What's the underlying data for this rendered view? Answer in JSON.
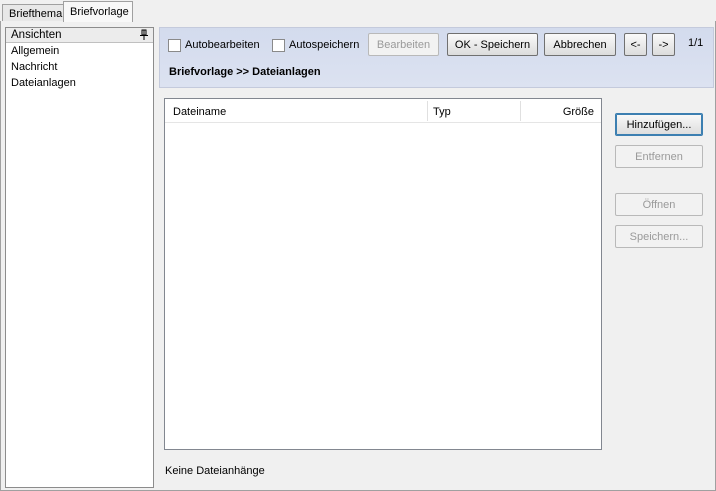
{
  "tabs": [
    {
      "label": "Briefthema",
      "active": false
    },
    {
      "label": "Briefvorlage",
      "active": true
    }
  ],
  "sidebar": {
    "header": "Ansichten",
    "items": [
      {
        "label": "Allgemein"
      },
      {
        "label": "Nachricht"
      },
      {
        "label": "Dateianlagen"
      }
    ]
  },
  "toolbar": {
    "autoedit_label": "Autobearbeiten",
    "autoedit_checked": false,
    "autosave_label": "Autospeichern",
    "autosave_checked": false,
    "edit_label": "Bearbeiten",
    "ok_save_label": "OK - Speichern",
    "cancel_label": "Abbrechen",
    "prev_label": "<-",
    "next_label": "->",
    "page_count": "1/1",
    "breadcrumb": "Briefvorlage >> Dateianlagen"
  },
  "attachments": {
    "columns": [
      "Dateiname",
      "Typ",
      "Größe"
    ],
    "rows": [],
    "status": "Keine Dateianhänge"
  },
  "actions": {
    "add_label": "Hinzufügen...",
    "remove_label": "Entfernen",
    "open_label": "Öffnen",
    "save_label": "Speichern..."
  },
  "colors": {
    "toolbar_bg": "#d3dbed",
    "window_bg": "#f0f0f0",
    "focus_border": "#3c7fb1",
    "disabled_text": "#9a9a9a"
  }
}
